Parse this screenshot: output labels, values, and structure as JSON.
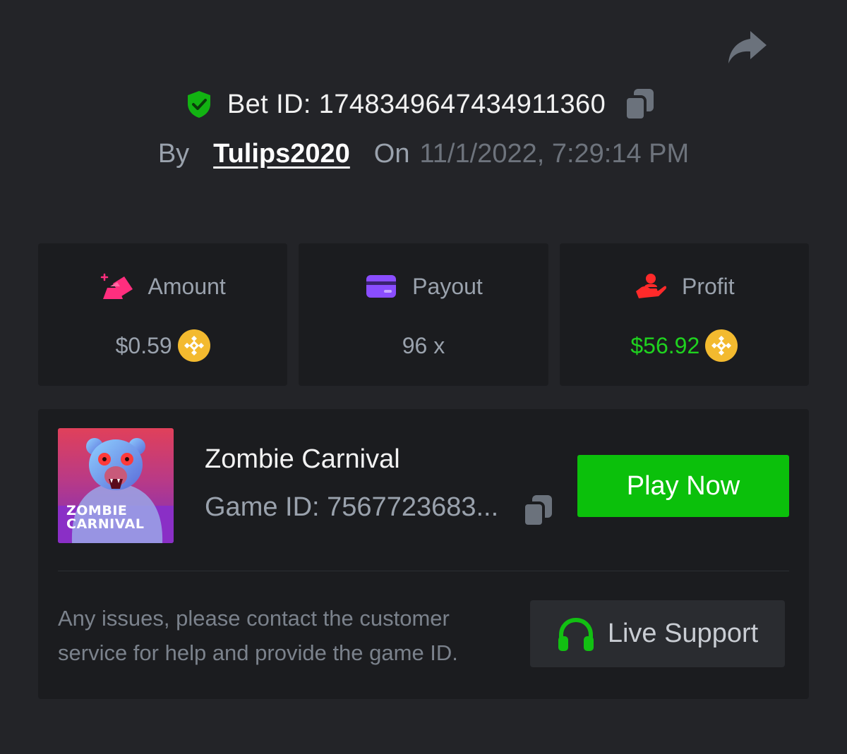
{
  "bet": {
    "id_label": "Bet ID: 1748349647434911360",
    "by_label": "By",
    "username": "Tulips2020",
    "on_label": "On",
    "date": "11/1/2022, 7:29:14 PM"
  },
  "stats": {
    "amount": {
      "label": "Amount",
      "value": "$0.59"
    },
    "payout": {
      "label": "Payout",
      "value": "96 x"
    },
    "profit": {
      "label": "Profit",
      "value": "$56.92"
    }
  },
  "game": {
    "name": "Zombie Carnival",
    "id_label": "Game ID: 7567723683...",
    "thumb_line1": "ZOMBIE",
    "thumb_line2": "CARNIVAL",
    "play_label": "Play Now"
  },
  "support": {
    "help_text": "Any issues, please contact the customer service for help and provide the game ID.",
    "button_label": "Live Support"
  },
  "colors": {
    "background": "#232428",
    "card": "#1b1c1f",
    "accent_green": "#0bc00b",
    "profit_green": "#1fd21f",
    "coin": "#f3ba2f",
    "amount_icon": "#ff2e7e",
    "payout_icon": "#8a4dff",
    "profit_icon": "#ff2a2a"
  },
  "icons": {
    "share": "share-icon",
    "verified": "shield-check-icon",
    "copy": "copy-icon",
    "amount": "bet-amount-icon",
    "payout": "card-icon",
    "profit": "profit-hand-icon",
    "coin": "bnb-coin-icon",
    "support": "headphones-icon"
  }
}
